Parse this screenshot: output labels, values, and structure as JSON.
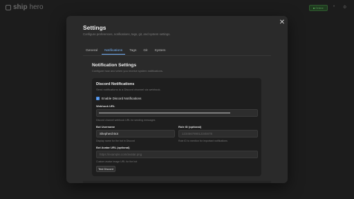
{
  "app": {
    "logo_text": "ship",
    "logo_text_muted": "hero",
    "status": "Online",
    "header_icon_1": "•",
    "header_icon_2": "⚙"
  },
  "modal": {
    "title": "Settings",
    "subtitle": "Configure preferences, notifications, tags, git, and system settings.",
    "close_glyph": "✕",
    "tabs": [
      {
        "label": "General",
        "active": false
      },
      {
        "label": "Notifications",
        "active": true
      },
      {
        "label": "Tags",
        "active": false
      },
      {
        "label": "Git",
        "active": false
      },
      {
        "label": "System",
        "active": false
      }
    ]
  },
  "notifications": {
    "title": "Notification Settings",
    "subtitle": "Configure how and when you receive system notifications."
  },
  "discord": {
    "title": "Discord Notifications",
    "subtitle": "Send notifications to a Discord channel via webhook.",
    "enable_label": "Enable Discord Notifications",
    "enabled": true,
    "webhook_label": "Webhook URL",
    "webhook_help": "Discord channel webhook URL for sending messages",
    "bot_username_label": "Bot Username",
    "bot_username_value": "Shepherd Bot",
    "bot_username_help": "Display name for the bot in Discord",
    "role_id_label": "Role ID (optional)",
    "role_id_placeholder": "123456789012345678",
    "role_id_help": "Role ID to mention for important notifications",
    "avatar_label": "Bot Avatar URL (optional)",
    "avatar_placeholder": "https://example.com/avatar.png",
    "avatar_help": "Custom avatar image URL for the bot",
    "test_button": "Test Discord"
  },
  "colors": {
    "accent": "#7ab8ff",
    "checkbox": "#4a8fe8",
    "modal_bg": "#2a2a2a",
    "card_bg": "#1e1e1e"
  },
  "icons": {
    "close": "close-icon",
    "check": "check-icon",
    "logo": "logo-icon"
  }
}
